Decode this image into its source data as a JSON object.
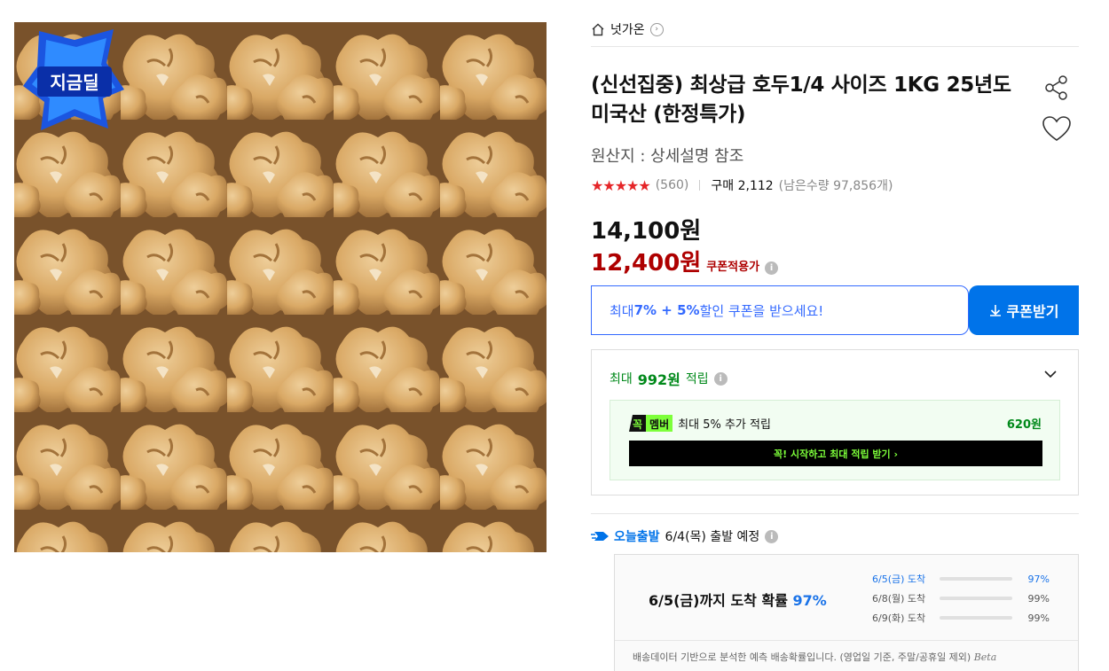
{
  "breadcrumb": {
    "home_label": "넛가온",
    "chevron": "›"
  },
  "product": {
    "title": "(신선집중) 최상급 호두1/4 사이즈 1KG 25년도 미국산 (한정특가)",
    "origin": "원산지 : 상세설명 참조",
    "rating_stars": "★★★★★",
    "rating": 4.5,
    "review_count": "(560)",
    "purchase_text": "구매 2,112",
    "remaining_text": "(남은수량 97,856개)",
    "badge_label": "지금딜"
  },
  "price": {
    "original": "14,100원",
    "coupon": "12,400원",
    "coupon_label": "쿠폰적용가",
    "info_icon": "i"
  },
  "coupon": {
    "text_prefix": "최대 ",
    "text_highlight": "7% + 5%",
    "text_suffix": " 할인 쿠폰을 받으세요!",
    "button_label": "쿠폰받기"
  },
  "reward": {
    "prefix": "최대 ",
    "amount": "992원",
    "suffix": " 적립",
    "member_badge_1": "꼭",
    "member_badge_2": "멤버",
    "member_text": "최대 5% 추가 적립",
    "member_amount": "620원",
    "member_cta": "꼭! 시작하고 최대 적립 받기 ›"
  },
  "shipping": {
    "rocket_label": "오늘출발",
    "departure": "6/4(목) 출발 예정"
  },
  "probability": {
    "main_prefix": "6/5(금)까지 도착 확률 ",
    "main_pct": "97%",
    "items": [
      {
        "label": "6/5(금) 도착",
        "pct": "97%",
        "value": 0.97
      },
      {
        "label": "6/8(월) 도착",
        "pct": "99%",
        "value": 0.0
      },
      {
        "label": "6/9(화) 도착",
        "pct": "99%",
        "value": 0.0
      }
    ],
    "footnote": "배송데이터 기반으로 분석한 예측 배송확률입니다. (영업일 기준, 주말/공휴일 제외)",
    "beta": "Beta"
  },
  "colors": {
    "accent": "#0073e9",
    "sale": "#ae0000",
    "reward": "#00891a",
    "star": "#e52528"
  }
}
